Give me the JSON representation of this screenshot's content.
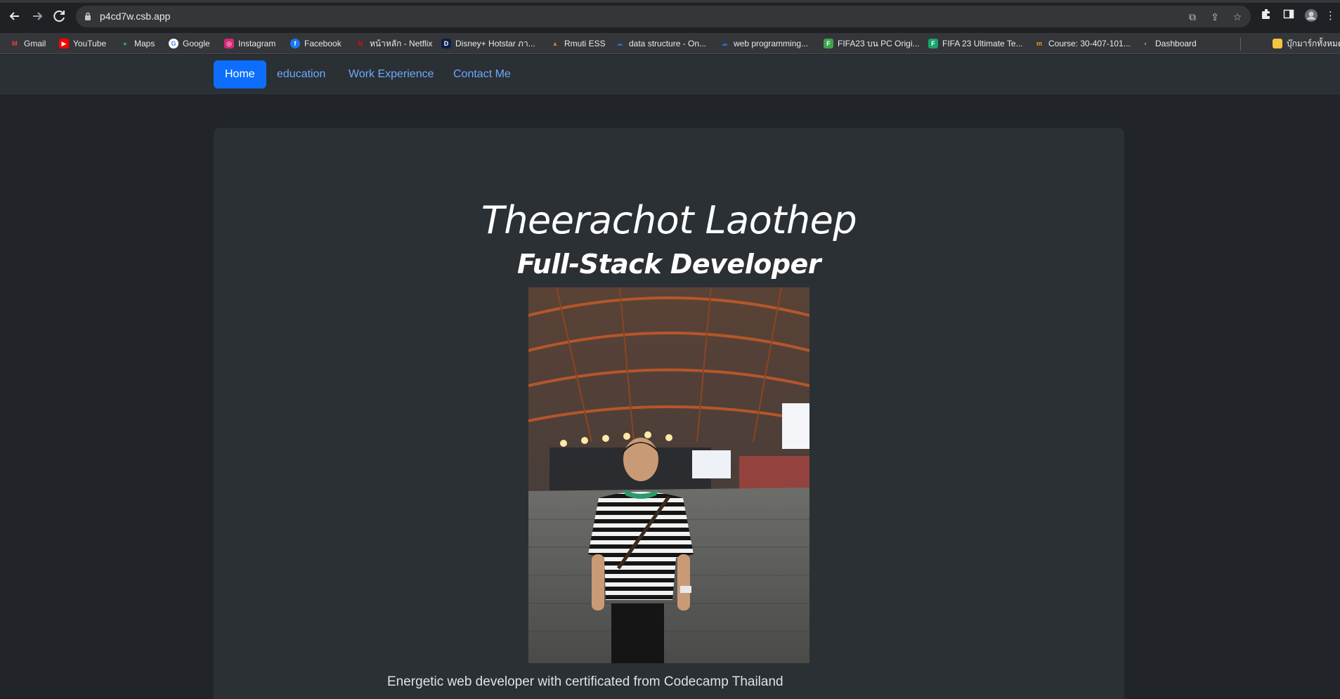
{
  "browser": {
    "url": "p4cd7w.csb.app"
  },
  "bookmarks": [
    {
      "label": "Gmail",
      "color": "#ea4335",
      "glyph": "M"
    },
    {
      "label": "YouTube",
      "color": "#ff0000",
      "glyph": "▶"
    },
    {
      "label": "Maps",
      "color": "#34a853",
      "glyph": "●"
    },
    {
      "label": "Google",
      "color": "#ffffff",
      "glyph": "G"
    },
    {
      "label": "Instagram",
      "color": "#d62976",
      "glyph": "◎"
    },
    {
      "label": "Facebook",
      "color": "#1877f2",
      "glyph": "f"
    },
    {
      "label": "หน้าหลัก - Netflix",
      "color": "#e50914",
      "glyph": "N"
    },
    {
      "label": "Disney+ Hotstar ภา...",
      "color": "#0c1f4a",
      "glyph": "D"
    },
    {
      "label": "Rmuti ESS",
      "color": "#d07a2a",
      "glyph": "▲"
    },
    {
      "label": "data structure - On...",
      "color": "#0f78d4",
      "glyph": "☁"
    },
    {
      "label": "web programming...",
      "color": "#0f78d4",
      "glyph": "☁"
    },
    {
      "label": "FIFA23 บน PC Origi...",
      "color": "#3ea34a",
      "glyph": "F"
    },
    {
      "label": "FIFA 23 Ultimate Te...",
      "color": "#18a36b",
      "glyph": "F"
    },
    {
      "label": "Course: 30-407-101...",
      "color": "#f29a1b",
      "glyph": "m"
    },
    {
      "label": "Dashboard",
      "color": "#8a8f98",
      "glyph": "◐"
    },
    {
      "label": "บุ๊กมาร์กทั้งหมด",
      "color": "#f6c441",
      "glyph": ""
    }
  ],
  "navbar": {
    "links": [
      "Home",
      "education",
      "Work Experience",
      "Contact Me"
    ],
    "active_index": 0
  },
  "hero": {
    "name": "Theerachot Laothep",
    "role": "Full-Stack Developer",
    "bio": "Energetic web developer with certificated from Codecamp Thailand"
  },
  "colors": {
    "page_bg": "#212529",
    "card_bg": "#2b3035",
    "link": "#6ea8fe",
    "active": "#0d6efd"
  }
}
